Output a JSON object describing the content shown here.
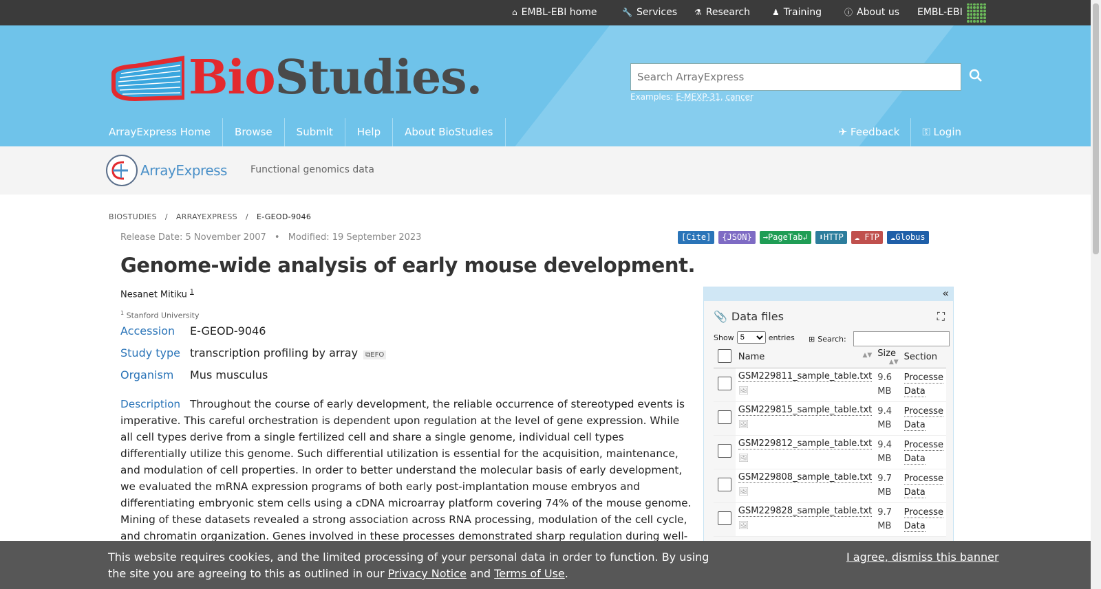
{
  "ebi_bar": {
    "items": [
      "EMBL-EBI home",
      "Services",
      "Research",
      "Training",
      "About us"
    ],
    "brand": "EMBL-EBI"
  },
  "masthead": {
    "logo_bio": "Bio",
    "logo_studies": "Studies.",
    "search_placeholder": "Search ArrayExpress",
    "examples_label": "Examples:",
    "example_1": "E-MEXP-31",
    "example_2": "cancer",
    "nav": [
      "ArrayExpress Home",
      "Browse",
      "Submit",
      "Help",
      "About BioStudies"
    ],
    "nav_right": [
      "Feedback",
      "Login"
    ]
  },
  "subheader": {
    "brand": "ArrayExpress",
    "tagline": "Functional genomics data"
  },
  "breadcrumb": [
    "BIOSTUDIES",
    "ARRAYEXPRESS",
    "E-GEOD-9046"
  ],
  "dates": {
    "release": "Release Date: 5 November 2007",
    "modified": "Modified: 19 September 2023"
  },
  "badges": [
    {
      "label": "[Cite]",
      "color": "#2a74b8"
    },
    {
      "label": "{JSON}",
      "color": "#7e6bc4"
    },
    {
      "label": "→PageTab↲",
      "color": "#1f9d55"
    },
    {
      "label": "HTTP",
      "color": "#2c7d9c"
    },
    {
      "label": "FTP",
      "color": "#c0504d"
    },
    {
      "label": "Globus",
      "color": "#1f5fa8"
    }
  ],
  "study": {
    "title": "Genome-wide analysis of early mouse development.",
    "author": "Nesanet Mitiku",
    "author_sup": "1",
    "affil_sup": "1",
    "affiliation": "Stanford University",
    "accession_label": "Accession",
    "accession": "E-GEOD-9046",
    "study_type_label": "Study type",
    "study_type": "transcription profiling by array",
    "efo": "EFO",
    "organism_label": "Organism",
    "organism": "Mus musculus",
    "description_label": "Description",
    "description": "Throughout the course of early development, the reliable occurrence of stereotyped events is imperative. This careful orchestration is dependent upon regulation at the level of gene expression. While all cell types derive from a single fertilized cell and share a single genome, individual cell types differentially utilize this genome. Such differential utilization is essential for the acquisition, maintenance, and modulation of cell properties. In order to better understand the molecular basis of early development, we evaluated the mRNA expression programs of both early post-implantation mouse embryos and differentiating embryonic stem cells using a cDNA microarray platform covering 74% of the mouse genome. Mining of these datasets revealed a strong association across RNA processing, modulation of the cell cycle, and chromatin organization. Genes involved in these processes demonstrated sharp regulation during well-defined biological transitions. Dominant patterns of expression with"
  },
  "data_files": {
    "title": "Data files",
    "show_label": "Show",
    "show_value": "5",
    "entries_label": "entries",
    "search_label": "Search:",
    "columns": [
      "Name",
      "Size",
      "Section"
    ],
    "rows": [
      {
        "name": "GSM229811_sample_table.txt",
        "size_a": "9.6",
        "size_b": "MB",
        "sec_a": "Processe",
        "sec_b": "Data"
      },
      {
        "name": "GSM229815_sample_table.txt",
        "size_a": "9.4",
        "size_b": "MB",
        "sec_a": "Processe",
        "sec_b": "Data"
      },
      {
        "name": "GSM229812_sample_table.txt",
        "size_a": "9.4",
        "size_b": "MB",
        "sec_a": "Processe",
        "sec_b": "Data"
      },
      {
        "name": "GSM229808_sample_table.txt",
        "size_a": "9.7",
        "size_b": "MB",
        "sec_a": "Processe",
        "sec_b": "Data"
      },
      {
        "name": "GSM229828_sample_table.txt",
        "size_a": "9.7",
        "size_b": "MB",
        "sec_a": "Processe",
        "sec_b": "Data"
      }
    ]
  },
  "cookie": {
    "text_1": "This website requires cookies, and the limited processing of your personal data in order to function. By using the site you are agreeing to this as outlined in our",
    "privacy": "Privacy Notice",
    "and": "and",
    "terms": "Terms of Use",
    "period": ".",
    "agree": "I agree, dismiss this banner"
  }
}
